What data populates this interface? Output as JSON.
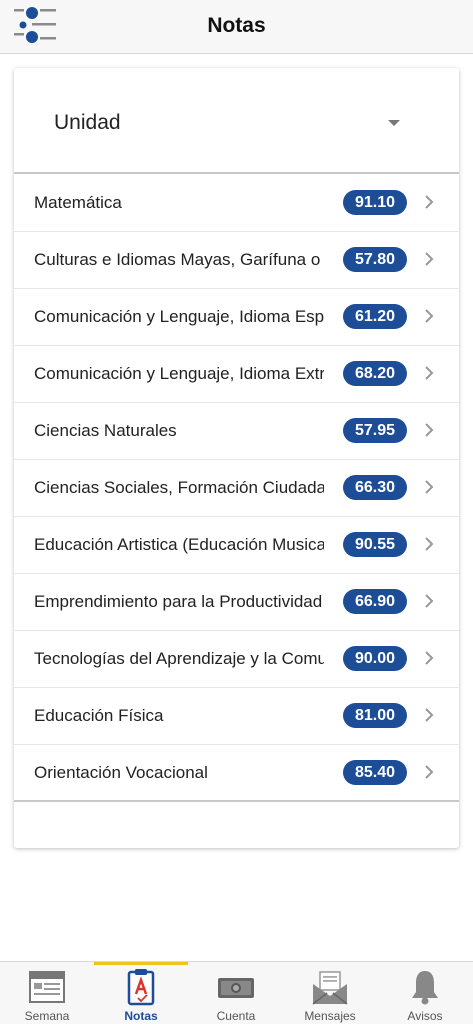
{
  "header": {
    "title": "Notas",
    "menu_icon": "logo-menu-icon"
  },
  "selector": {
    "label": "Unidad"
  },
  "subjects": [
    {
      "name": "Matemática",
      "grade": "91.10"
    },
    {
      "name": "Culturas e Idiomas Mayas, Garífuna o Xinka",
      "grade": "57.80"
    },
    {
      "name": "Comunicación y Lenguaje, Idioma Español",
      "grade": "61.20"
    },
    {
      "name": "Comunicación y Lenguaje, Idioma Extranjero",
      "grade": "68.20"
    },
    {
      "name": "Ciencias Naturales",
      "grade": "57.95"
    },
    {
      "name": "Ciencias Sociales, Formación Ciudadana",
      "grade": "66.30"
    },
    {
      "name": "Educación Artistica (Educación Musical)",
      "grade": "90.55"
    },
    {
      "name": "Emprendimiento para la Productividad",
      "grade": "66.90"
    },
    {
      "name": "Tecnologías del Aprendizaje y la Comunicación",
      "grade": "90.00"
    },
    {
      "name": "Educación Física",
      "grade": "81.00"
    },
    {
      "name": "Orientación Vocacional",
      "grade": "85.40"
    }
  ],
  "tabs": [
    {
      "label": "Semana",
      "icon": "calendar-icon"
    },
    {
      "label": "Notas",
      "icon": "report-card-icon",
      "active": true
    },
    {
      "label": "Cuenta",
      "icon": "money-icon"
    },
    {
      "label": "Mensajes",
      "icon": "envelope-icon"
    },
    {
      "label": "Avisos",
      "icon": "bell-icon"
    }
  ],
  "colors": {
    "accent": "#1c4d96",
    "tab_indicator": "#f0c419"
  }
}
